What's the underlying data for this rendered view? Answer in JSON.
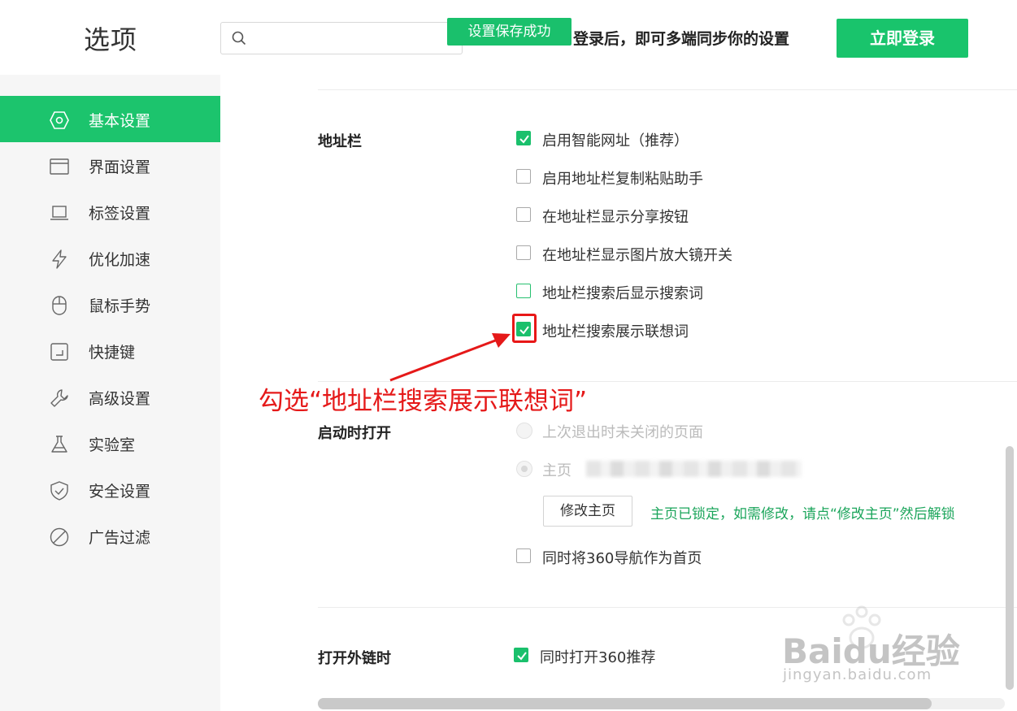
{
  "header": {
    "title": "选项",
    "search_placeholder": "",
    "toast": "设置保存成功",
    "login_tip": "登录后，即可多端同步你的设置",
    "login_button": "立即登录"
  },
  "sidebar": {
    "items": [
      {
        "label": "基本设置",
        "icon": "hexagon-settings-icon",
        "active": true
      },
      {
        "label": "界面设置",
        "icon": "window-icon",
        "active": false
      },
      {
        "label": "标签设置",
        "icon": "laptop-tab-icon",
        "active": false
      },
      {
        "label": "优化加速",
        "icon": "lightning-icon",
        "active": false
      },
      {
        "label": "鼠标手势",
        "icon": "mouse-icon",
        "active": false
      },
      {
        "label": "快捷键",
        "icon": "shortcut-key-icon",
        "active": false
      },
      {
        "label": "高级设置",
        "icon": "wrench-icon",
        "active": false
      },
      {
        "label": "实验室",
        "icon": "flask-icon",
        "active": false
      },
      {
        "label": "安全设置",
        "icon": "shield-check-icon",
        "active": false
      },
      {
        "label": "广告过滤",
        "icon": "block-icon",
        "active": false
      }
    ]
  },
  "address_bar": {
    "title": "地址栏",
    "options": [
      {
        "label": "启用智能网址（推荐）",
        "checked": true
      },
      {
        "label": "启用地址栏复制粘贴助手",
        "checked": false
      },
      {
        "label": "在地址栏显示分享按钮",
        "checked": false
      },
      {
        "label": "在地址栏显示图片放大镜开关",
        "checked": false
      },
      {
        "label": "地址栏搜索后显示搜索词",
        "checked": false
      },
      {
        "label": "地址栏搜索展示联想词",
        "checked": true
      }
    ]
  },
  "annotation": {
    "text": "勾选“地址栏搜索展示联想词”"
  },
  "startup": {
    "title": "启动时打开",
    "option_restore": "上次退出时未关闭的页面",
    "option_home": "主页",
    "modify_home_button": "修改主页",
    "lock_note": "主页已锁定，如需修改，请点“修改主页”然后解锁",
    "nav_as_home": "同时将360导航作为首页",
    "nav_as_home_checked": false
  },
  "external_link": {
    "title": "打开外链时",
    "option": "同时打开360推荐",
    "checked": true
  },
  "watermark": {
    "main": "Baidu经验",
    "sub": "jingyan.baidu.com"
  },
  "colors": {
    "accent": "#1ac06c",
    "annotation": "#e51919",
    "lock_note": "#1ba55b"
  }
}
